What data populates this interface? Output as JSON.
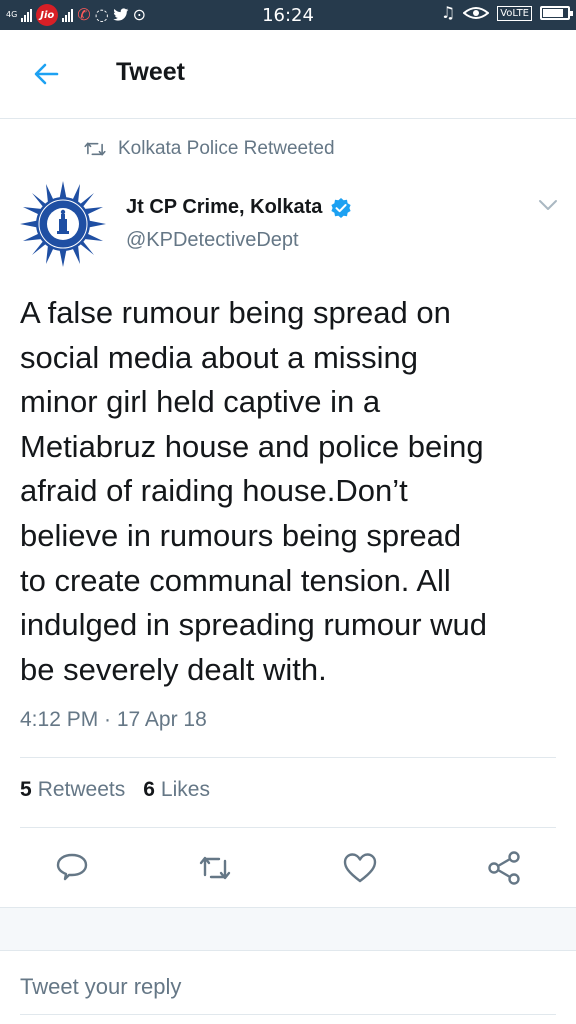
{
  "status_bar": {
    "network_label": "4G",
    "carrier": "Jio",
    "time": "16:24",
    "volte": "VoLTE",
    "battery_level": 0.85
  },
  "header": {
    "title": "Tweet"
  },
  "retweet_banner": {
    "text": "Kolkata Police Retweeted"
  },
  "author": {
    "name": "Jt CP Crime, Kolkata",
    "handle": "@KPDetectiveDept",
    "verified": true,
    "avatar_text": "KOLKATA POLICE"
  },
  "tweet": {
    "text": "A false rumour being spread  on\nsocial media about a missing\nminor girl held captive in a\nMetiabruz house and police being\nafraid of raiding house.Don’t\nbelieve in rumours being spread\nto create communal tension. All\nindulged in spreading rumour wud\nbe severely dealt with.",
    "time": "4:12 PM",
    "date": "17 Apr 18",
    "meta": "4:12 PM · 17 Apr 18"
  },
  "stats": {
    "retweets_count": "5",
    "retweets_label": "Retweets",
    "likes_count": "6",
    "likes_label": "Likes"
  },
  "actions": [
    "reply-icon",
    "retweet-icon",
    "like-icon",
    "share-icon"
  ],
  "reply_box": {
    "placeholder": "Tweet your reply"
  },
  "colors": {
    "status_bar": "#263a4c",
    "accent": "#1da1f2",
    "secondary_text": "#657786",
    "divider": "#e1e8ed",
    "police_badge": "#1f4fa3"
  }
}
